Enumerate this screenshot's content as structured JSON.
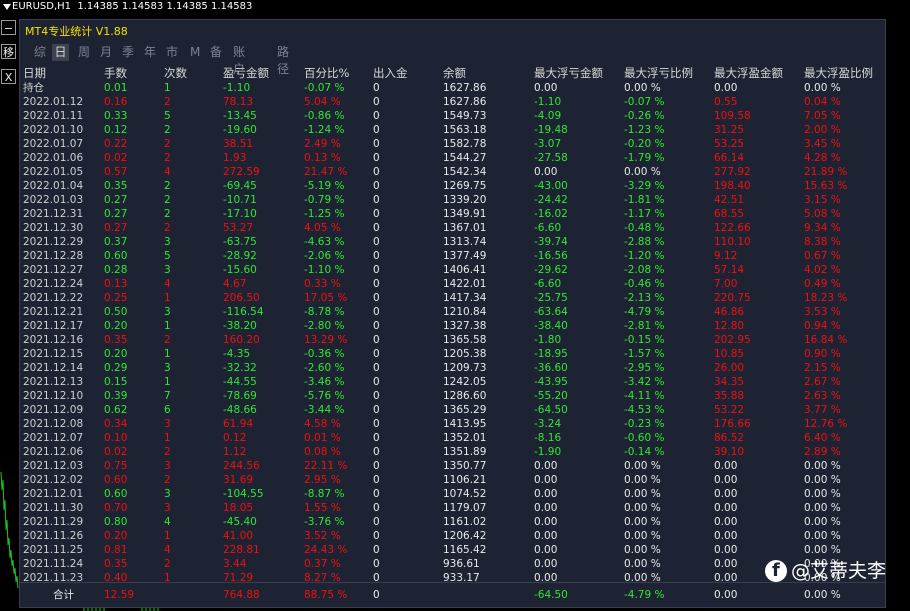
{
  "chart": {
    "symbol": "EURUSD,H1",
    "ohlc": "1.14385 1.14583 1.14385 1.14583"
  },
  "side_buttons": [
    "−",
    "移",
    "X"
  ],
  "panel": {
    "title": "MT4专业统计 V1.88"
  },
  "tabs": [
    "综",
    "日",
    "周",
    "月",
    "季",
    "年",
    "市",
    "M",
    "备",
    "账户",
    "路径"
  ],
  "columns": [
    "日期",
    "手数",
    "次数",
    "盈亏金额",
    "百分比%",
    "出入金",
    "余额",
    "最大浮亏金额",
    "最大浮亏比例",
    "最大浮盈金额",
    "最大浮盈比例"
  ],
  "rows": [
    [
      "持仓",
      "0.01",
      "1",
      "-1.10",
      "-0.07 %",
      "0",
      "1627.86",
      "0.00",
      "0.00 %",
      "0.00",
      "0.00 %"
    ],
    [
      "2022.01.12",
      "0.16",
      "2",
      "78.13",
      "5.04 %",
      "0",
      "1627.86",
      "-1.10",
      "-0.07 %",
      "0.55",
      "0.04 %"
    ],
    [
      "2022.01.11",
      "0.33",
      "5",
      "-13.45",
      "-0.86 %",
      "0",
      "1549.73",
      "-4.09",
      "-0.26 %",
      "109.58",
      "7.05 %"
    ],
    [
      "2022.01.10",
      "0.12",
      "2",
      "-19.60",
      "-1.24 %",
      "0",
      "1563.18",
      "-19.48",
      "-1.23 %",
      "31.25",
      "2.00 %"
    ],
    [
      "2022.01.07",
      "0.22",
      "2",
      "38.51",
      "2.49 %",
      "0",
      "1582.78",
      "-3.07",
      "-0.20 %",
      "53.25",
      "3.45 %"
    ],
    [
      "2022.01.06",
      "0.02",
      "2",
      "1.93",
      "0.13 %",
      "0",
      "1544.27",
      "-27.58",
      "-1.79 %",
      "66.14",
      "4.28 %"
    ],
    [
      "2022.01.05",
      "0.57",
      "4",
      "272.59",
      "21.47 %",
      "0",
      "1542.34",
      "0.00",
      "0.00 %",
      "277.92",
      "21.89 %"
    ],
    [
      "2022.01.04",
      "0.35",
      "2",
      "-69.45",
      "-5.19 %",
      "0",
      "1269.75",
      "-43.00",
      "-3.29 %",
      "198.40",
      "15.63 %"
    ],
    [
      "2022.01.03",
      "0.27",
      "2",
      "-10.71",
      "-0.79 %",
      "0",
      "1339.20",
      "-24.42",
      "-1.81 %",
      "42.51",
      "3.15 %"
    ],
    [
      "2021.12.31",
      "0.27",
      "2",
      "-17.10",
      "-1.25 %",
      "0",
      "1349.91",
      "-16.02",
      "-1.17 %",
      "68.55",
      "5.08 %"
    ],
    [
      "2021.12.30",
      "0.27",
      "2",
      "53.27",
      "4.05 %",
      "0",
      "1367.01",
      "-6.60",
      "-0.48 %",
      "122.66",
      "9.34 %"
    ],
    [
      "2021.12.29",
      "0.37",
      "3",
      "-63.75",
      "-4.63 %",
      "0",
      "1313.74",
      "-39.74",
      "-2.88 %",
      "110.10",
      "8.38 %"
    ],
    [
      "2021.12.28",
      "0.60",
      "5",
      "-28.92",
      "-2.06 %",
      "0",
      "1377.49",
      "-16.56",
      "-1.20 %",
      "9.12",
      "0.67 %"
    ],
    [
      "2021.12.27",
      "0.28",
      "3",
      "-15.60",
      "-1.10 %",
      "0",
      "1406.41",
      "-29.62",
      "-2.08 %",
      "57.14",
      "4.02 %"
    ],
    [
      "2021.12.24",
      "0.13",
      "4",
      "4.67",
      "0.33 %",
      "0",
      "1422.01",
      "-6.60",
      "-0.46 %",
      "7.00",
      "0.49 %"
    ],
    [
      "2021.12.22",
      "0.25",
      "1",
      "206.50",
      "17.05 %",
      "0",
      "1417.34",
      "-25.75",
      "-2.13 %",
      "220.75",
      "18.23 %"
    ],
    [
      "2021.12.21",
      "0.50",
      "3",
      "-116.54",
      "-8.78 %",
      "0",
      "1210.84",
      "-63.64",
      "-4.79 %",
      "46.86",
      "3.53 %"
    ],
    [
      "2021.12.17",
      "0.20",
      "1",
      "-38.20",
      "-2.80 %",
      "0",
      "1327.38",
      "-38.40",
      "-2.81 %",
      "12.80",
      "0.94 %"
    ],
    [
      "2021.12.16",
      "0.35",
      "2",
      "160.20",
      "13.29 %",
      "0",
      "1365.58",
      "-1.80",
      "-0.15 %",
      "202.95",
      "16.84 %"
    ],
    [
      "2021.12.15",
      "0.20",
      "1",
      "-4.35",
      "-0.36 %",
      "0",
      "1205.38",
      "-18.95",
      "-1.57 %",
      "10.85",
      "0.90 %"
    ],
    [
      "2021.12.14",
      "0.29",
      "3",
      "-32.32",
      "-2.60 %",
      "0",
      "1209.73",
      "-36.60",
      "-2.95 %",
      "26.00",
      "2.15 %"
    ],
    [
      "2021.12.13",
      "0.15",
      "1",
      "-44.55",
      "-3.46 %",
      "0",
      "1242.05",
      "-43.95",
      "-3.42 %",
      "34.35",
      "2.67 %"
    ],
    [
      "2021.12.10",
      "0.39",
      "7",
      "-78.69",
      "-5.76 %",
      "0",
      "1286.60",
      "-55.20",
      "-4.11 %",
      "35.88",
      "2.63 %"
    ],
    [
      "2021.12.09",
      "0.62",
      "6",
      "-48.66",
      "-3.44 %",
      "0",
      "1365.29",
      "-64.50",
      "-4.53 %",
      "53.22",
      "3.77 %"
    ],
    [
      "2021.12.08",
      "0.34",
      "3",
      "61.94",
      "4.58 %",
      "0",
      "1413.95",
      "-3.24",
      "-0.23 %",
      "176.66",
      "12.76 %"
    ],
    [
      "2021.12.07",
      "0.10",
      "1",
      "0.12",
      "0.01 %",
      "0",
      "1352.01",
      "-8.16",
      "-0.60 %",
      "86.52",
      "6.40 %"
    ],
    [
      "2021.12.06",
      "0.02",
      "2",
      "1.12",
      "0.08 %",
      "0",
      "1351.89",
      "-1.90",
      "-0.14 %",
      "39.10",
      "2.89 %"
    ],
    [
      "2021.12.03",
      "0.75",
      "3",
      "244.56",
      "22.11 %",
      "0",
      "1350.77",
      "0.00",
      "0.00 %",
      "0.00",
      "0.00 %"
    ],
    [
      "2021.12.02",
      "0.60",
      "2",
      "31.69",
      "2.95 %",
      "0",
      "1106.21",
      "0.00",
      "0.00 %",
      "0.00",
      "0.00 %"
    ],
    [
      "2021.12.01",
      "0.60",
      "3",
      "-104.55",
      "-8.87 %",
      "0",
      "1074.52",
      "0.00",
      "0.00 %",
      "0.00",
      "0.00 %"
    ],
    [
      "2021.11.30",
      "0.70",
      "3",
      "18.05",
      "1.55 %",
      "0",
      "1179.07",
      "0.00",
      "0.00 %",
      "0.00",
      "0.00 %"
    ],
    [
      "2021.11.29",
      "0.80",
      "4",
      "-45.40",
      "-3.76 %",
      "0",
      "1161.02",
      "0.00",
      "0.00 %",
      "0.00",
      "0.00 %"
    ],
    [
      "2021.11.26",
      "0.20",
      "1",
      "41.00",
      "3.52 %",
      "0",
      "1206.42",
      "0.00",
      "0.00 %",
      "0.00",
      "0.00 %"
    ],
    [
      "2021.11.25",
      "0.81",
      "4",
      "228.81",
      "24.43 %",
      "0",
      "1165.42",
      "0.00",
      "0.00 %",
      "0.00",
      "0.00 %"
    ],
    [
      "2021.11.24",
      "0.35",
      "2",
      "3.44",
      "0.37 %",
      "0",
      "936.61",
      "0.00",
      "0.00 %",
      "0.00",
      "0.00 %"
    ],
    [
      "2021.11.23",
      "0.40",
      "1",
      "71.29",
      "8.27 %",
      "0",
      "933.17",
      "0.00",
      "0.00 %",
      "0.00",
      "0.00 %"
    ]
  ],
  "total": [
    "合计",
    "12.59",
    "",
    "764.88",
    "88.75 %",
    "0",
    "",
    "-64.50",
    "-4.79 %",
    "0.00",
    "0.00 %"
  ],
  "watermark": "@艾蒂夫李",
  "colors": {
    "panel_bg": "#1d2333",
    "profit": "#f20f0f",
    "loss": "#30e830",
    "title": "#f5e000",
    "tab_active_bg": "#3d4150"
  }
}
